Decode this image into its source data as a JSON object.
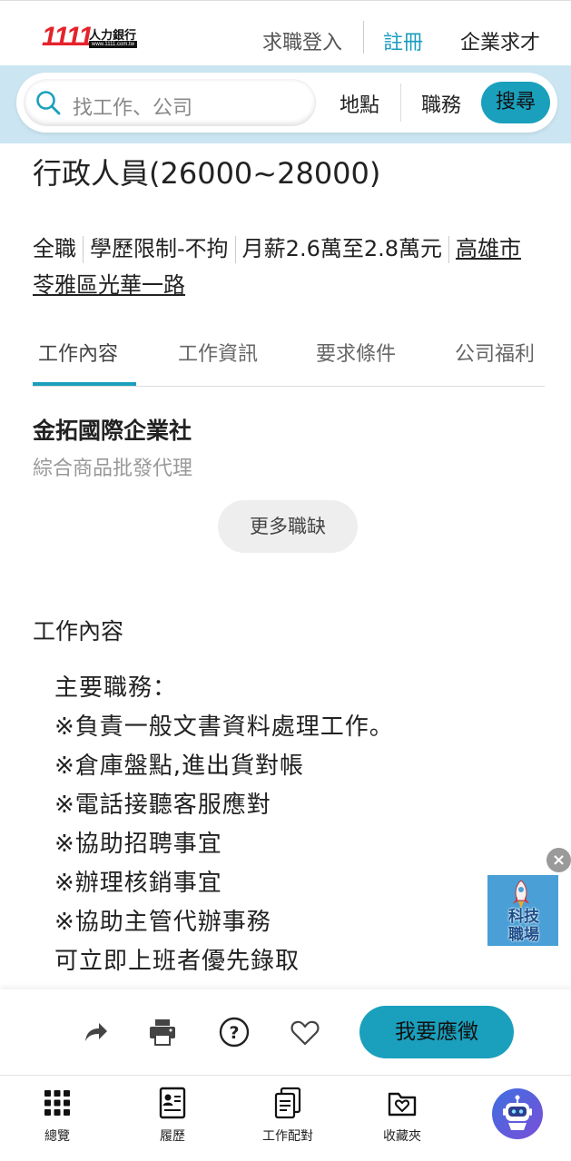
{
  "header": {
    "logo_number": "1111",
    "logo_brand": "人力銀行",
    "logo_url": "www.1111.com.tw",
    "login": "求職登入",
    "register": "註冊",
    "employer": "企業求才"
  },
  "search": {
    "placeholder": "找工作、公司",
    "location": "地點",
    "category": "職務",
    "button": "搜尋"
  },
  "job": {
    "title": "行政人員(26000~28000)",
    "type": "全職",
    "education": "學歷限制-不拘",
    "salary": "月薪2.6萬至2.8萬元",
    "address": "高雄市苓雅區光華一路"
  },
  "tabs": [
    "工作內容",
    "工作資訊",
    "要求條件",
    "公司福利"
  ],
  "company": {
    "name": "金拓國際企業社",
    "industry": "綜合商品批發代理",
    "more_jobs": "更多職缺"
  },
  "content": {
    "section_title": "工作內容",
    "lines": [
      "主要職務：",
      "※負責一般文書資料處理工作。",
      "※倉庫盤點,進出貨對帳",
      "※電話接聽客服應對",
      "※協助招聘事宜",
      "※辦理核銷事宜",
      "※協助主管代辦事務",
      "可立即上班者優先錄取"
    ]
  },
  "float_ad": {
    "line1": "科技",
    "line2": "職場",
    "close": "×"
  },
  "actions": {
    "apply": "我要應徵",
    "help_symbol": "?"
  },
  "bottom_nav": [
    "總覽",
    "履歷",
    "工作配對",
    "收藏夾"
  ],
  "colors": {
    "accent": "#1aa0bd",
    "search_band": "#cbe6f2",
    "logo_red": "#e5222b"
  }
}
